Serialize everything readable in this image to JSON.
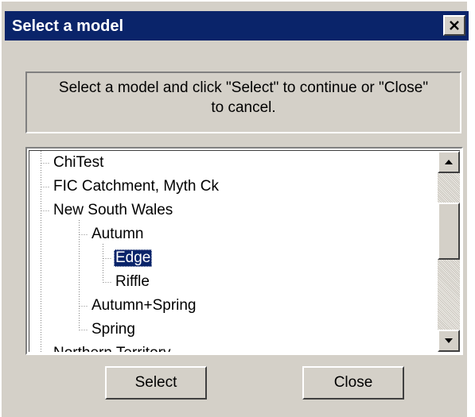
{
  "window": {
    "title": "Select a model",
    "close_icon": "close-icon"
  },
  "instructions": {
    "line1": "Select a model and click \"Select\" to continue or \"Close\"",
    "line2": "to cancel."
  },
  "tree": {
    "items": [
      {
        "label": "ChiTest",
        "level": 0
      },
      {
        "label": "FIC Catchment, Myth Ck",
        "level": 0
      },
      {
        "label": "New South Wales",
        "level": 0
      },
      {
        "label": "Autumn",
        "level": 1
      },
      {
        "label": "Edge",
        "level": 2,
        "selected": true
      },
      {
        "label": "Riffle",
        "level": 2
      },
      {
        "label": "Autumn+Spring",
        "level": 1
      },
      {
        "label": "Spring",
        "level": 1
      },
      {
        "label": "Northern Territory",
        "level": 0
      }
    ],
    "selection_color": "#0a246a",
    "scroll_up_icon": "arrow-up-icon",
    "scroll_down_icon": "arrow-down-icon"
  },
  "buttons": {
    "select_label": "Select",
    "close_label": "Close"
  },
  "colors": {
    "title_bar": "#0a246a",
    "dialog_face": "#d4d0c8"
  }
}
